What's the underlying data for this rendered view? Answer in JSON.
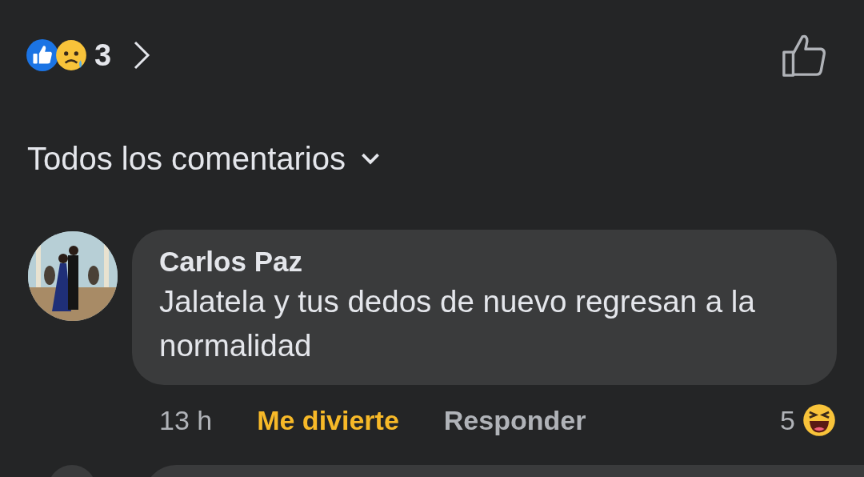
{
  "reactions": {
    "count": "3"
  },
  "filter": {
    "label": "Todos los comentarios"
  },
  "comments": [
    {
      "author": "Carlos Paz",
      "text": "Jalatela y tus dedos de nuevo regresan a la normalidad",
      "time": "13 h",
      "reaction_label": "Me divierte",
      "reacted": true,
      "reply_label": "Responder",
      "reaction_count": "5"
    }
  ]
}
